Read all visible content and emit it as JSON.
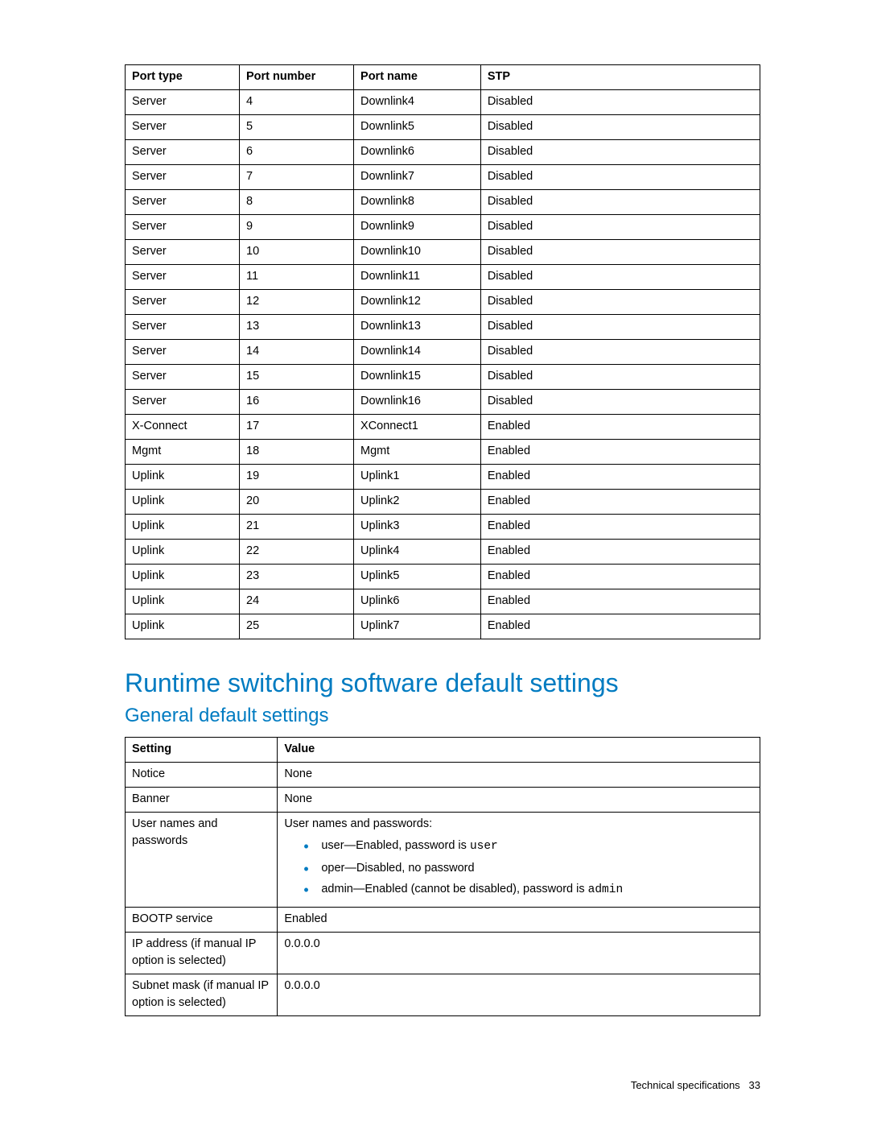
{
  "ports_table": {
    "headers": [
      "Port type",
      "Port number",
      "Port name",
      "STP"
    ],
    "rows": [
      [
        "Server",
        "4",
        "Downlink4",
        "Disabled"
      ],
      [
        "Server",
        "5",
        "Downlink5",
        "Disabled"
      ],
      [
        "Server",
        "6",
        "Downlink6",
        "Disabled"
      ],
      [
        "Server",
        "7",
        "Downlink7",
        "Disabled"
      ],
      [
        "Server",
        "8",
        "Downlink8",
        "Disabled"
      ],
      [
        "Server",
        "9",
        "Downlink9",
        "Disabled"
      ],
      [
        "Server",
        "10",
        "Downlink10",
        "Disabled"
      ],
      [
        "Server",
        "11",
        "Downlink11",
        "Disabled"
      ],
      [
        "Server",
        "12",
        "Downlink12",
        "Disabled"
      ],
      [
        "Server",
        "13",
        "Downlink13",
        "Disabled"
      ],
      [
        "Server",
        "14",
        "Downlink14",
        "Disabled"
      ],
      [
        "Server",
        "15",
        "Downlink15",
        "Disabled"
      ],
      [
        "Server",
        "16",
        "Downlink16",
        "Disabled"
      ],
      [
        "X-Connect",
        "17",
        "XConnect1",
        "Enabled"
      ],
      [
        "Mgmt",
        "18",
        "Mgmt",
        "Enabled"
      ],
      [
        "Uplink",
        "19",
        "Uplink1",
        "Enabled"
      ],
      [
        "Uplink",
        "20",
        "Uplink2",
        "Enabled"
      ],
      [
        "Uplink",
        "21",
        "Uplink3",
        "Enabled"
      ],
      [
        "Uplink",
        "22",
        "Uplink4",
        "Enabled"
      ],
      [
        "Uplink",
        "23",
        "Uplink5",
        "Enabled"
      ],
      [
        "Uplink",
        "24",
        "Uplink6",
        "Enabled"
      ],
      [
        "Uplink",
        "25",
        "Uplink7",
        "Enabled"
      ]
    ]
  },
  "headings": {
    "section": "Runtime switching software default settings",
    "subsection": "General default settings"
  },
  "settings_table": {
    "headers": [
      "Setting",
      "Value"
    ],
    "rows": [
      {
        "setting": "Notice",
        "value": "None"
      },
      {
        "setting": "Banner",
        "value": "None"
      },
      {
        "setting": "User names and passwords",
        "value_intro": "User names and passwords:",
        "bullets": [
          {
            "prefix": "user—Enabled, password is ",
            "mono": "user",
            "suffix": ""
          },
          {
            "prefix": "oper—Disabled, no password",
            "mono": "",
            "suffix": ""
          },
          {
            "prefix": "admin—Enabled (cannot be disabled), password is ",
            "mono": "admin",
            "suffix": ""
          }
        ]
      },
      {
        "setting": "BOOTP service",
        "value": "Enabled"
      },
      {
        "setting": "IP address (if manual IP option is selected)",
        "value": "0.0.0.0"
      },
      {
        "setting": "Subnet mask (if manual IP option is selected)",
        "value": "0.0.0.0"
      }
    ]
  },
  "footer": {
    "label": "Technical specifications",
    "page": "33"
  }
}
